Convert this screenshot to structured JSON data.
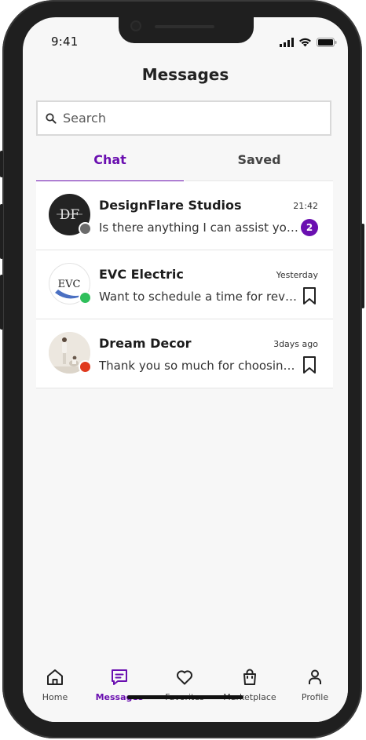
{
  "status_bar": {
    "time": "9:41"
  },
  "header": {
    "title": "Messages"
  },
  "search": {
    "placeholder": "Search"
  },
  "tabs": [
    {
      "label": "Chat",
      "active": true
    },
    {
      "label": "Saved",
      "active": false
    }
  ],
  "conversations": [
    {
      "name": "DesignFlare Studios",
      "preview": "Is there anything I can assist you with?",
      "time": "21:42",
      "unread": "2",
      "avatar_text": "DF",
      "presence_color": "#6b6b6b"
    },
    {
      "name": "EVC Electric",
      "preview": "Want to schedule a time for review?",
      "time": "Yesterday",
      "avatar_text": "EVC",
      "presence_color": "#2fbf5b"
    },
    {
      "name": "Dream Decor",
      "preview": "Thank you so much for choosing us!",
      "time": "3days ago",
      "presence_color": "#e03a1f"
    }
  ],
  "bottom_nav": [
    {
      "label": "Home",
      "icon": "home-icon",
      "active": false
    },
    {
      "label": "Messages",
      "icon": "message-icon",
      "active": true
    },
    {
      "label": "Favorites",
      "icon": "heart-icon",
      "active": false
    },
    {
      "label": "Marketplace",
      "icon": "shopping-bag-icon",
      "active": false
    },
    {
      "label": "Profile",
      "icon": "person-icon",
      "active": false
    }
  ],
  "colors": {
    "accent": "#6a0fb0",
    "online": "#2fbf5b",
    "busy": "#e03a1f",
    "away": "#6b6b6b"
  }
}
